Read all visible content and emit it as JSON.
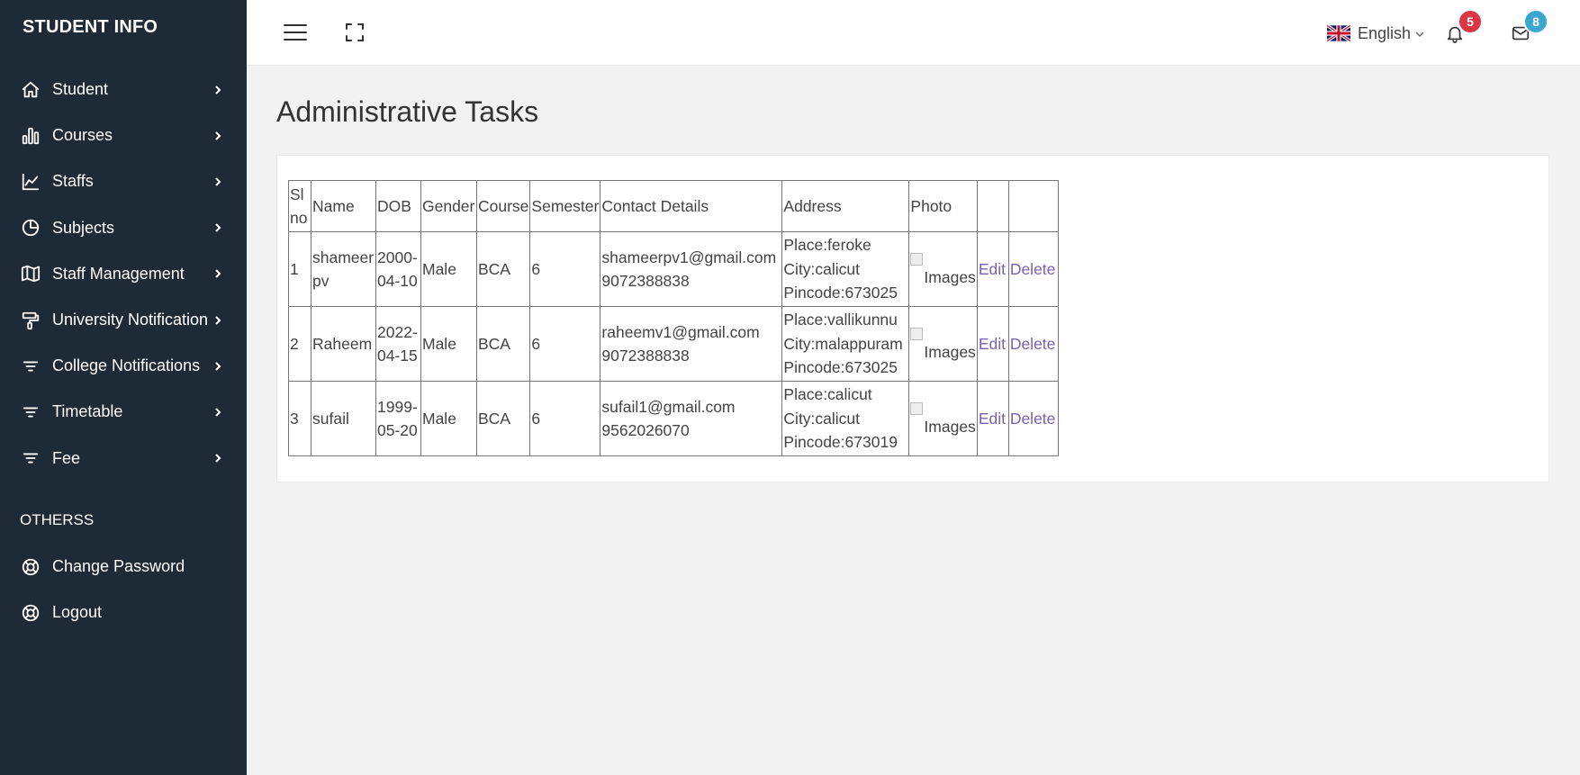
{
  "app": {
    "brand": "STUDENT INFO"
  },
  "sidebar": {
    "items": [
      {
        "label": "Student"
      },
      {
        "label": "Courses"
      },
      {
        "label": "Staffs"
      },
      {
        "label": "Subjects"
      },
      {
        "label": "Staff Management"
      },
      {
        "label": "University Notification"
      },
      {
        "label": "College Notifications"
      },
      {
        "label": "Timetable"
      },
      {
        "label": "Fee"
      }
    ],
    "section_title": "OTHERSS",
    "other_items": [
      {
        "label": "Change Password"
      },
      {
        "label": "Logout"
      }
    ]
  },
  "header": {
    "language": "English",
    "notifications_count": "5",
    "messages_count": "8"
  },
  "page": {
    "title": "Administrative Tasks"
  },
  "table": {
    "headers": [
      "Sl no",
      "Name",
      "DOB",
      "Gender",
      "Course",
      "Semester",
      "Contact Details",
      "Address",
      "Photo",
      "",
      ""
    ],
    "rows": [
      {
        "sl": "1",
        "name": "shameer pv",
        "dob": "2000-04-10",
        "gender": "Male",
        "course": "BCA",
        "semester": "6",
        "email": "shameerpv1@gmail.com",
        "phone": "9072388838",
        "place": "Place:feroke",
        "city": "City:calicut",
        "pincode": "Pincode:673025",
        "photo_alt": "Images",
        "edit": "Edit",
        "delete": "Delete"
      },
      {
        "sl": "2",
        "name": "Raheem",
        "dob": "2022-04-15",
        "gender": "Male",
        "course": "BCA",
        "semester": "6",
        "email": "raheemv1@gmail.com",
        "phone": "9072388838",
        "place": "Place:vallikunnu",
        "city": "City:malappuram",
        "pincode": "Pincode:673025",
        "photo_alt": "Images",
        "edit": "Edit",
        "delete": "Delete"
      },
      {
        "sl": "3",
        "name": "sufail",
        "dob": "1999-05-20",
        "gender": "Male",
        "course": "BCA",
        "semester": "6",
        "email": "sufail1@gmail.com",
        "phone": "9562026070",
        "place": "Place:calicut",
        "city": "City:calicut",
        "pincode": "Pincode:673019",
        "photo_alt": "Images",
        "edit": "Edit",
        "delete": "Delete"
      }
    ]
  },
  "colors": {
    "sidebar_bg": "#1e2a35",
    "link": "#7b5fb3",
    "badge_red": "#dc3545",
    "badge_blue": "#3ba6d0"
  }
}
